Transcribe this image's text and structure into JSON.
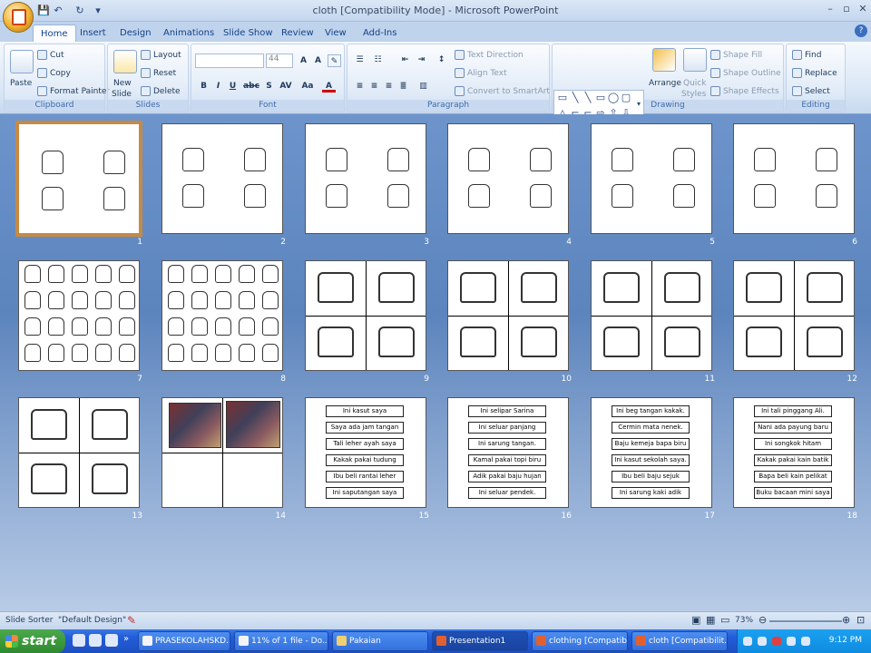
{
  "window": {
    "title": "cloth [Compatibility Mode] - Microsoft PowerPoint",
    "min": "–",
    "restore": "▫",
    "close": "✕"
  },
  "ribbon_tabs": [
    "Home",
    "Insert",
    "Design",
    "Animations",
    "Slide Show",
    "Review",
    "View",
    "Add-Ins"
  ],
  "active_tab": "Home",
  "clipboard": {
    "paste": "Paste",
    "cut": "Cut",
    "copy": "Copy",
    "format_painter": "Format Painter",
    "label": "Clipboard"
  },
  "slides_group": {
    "new_slide_1": "New",
    "new_slide_2": "Slide",
    "layout": "Layout",
    "reset": "Reset",
    "delete": "Delete",
    "label": "Slides"
  },
  "font_group": {
    "font_size": "44",
    "bold": "B",
    "italic": "I",
    "underline": "U",
    "strike": "abc",
    "shadow": "S",
    "spacing": "AV",
    "case": "Aa",
    "color": "A",
    "grow": "A",
    "shrink": "A",
    "label": "Font"
  },
  "paragraph_group": {
    "text_direction": "Text Direction",
    "align_text": "Align Text",
    "convert_smartart": "Convert to SmartArt",
    "label": "Paragraph"
  },
  "drawing_group": {
    "arrange": "Arrange",
    "quick_styles_1": "Quick",
    "quick_styles_2": "Styles",
    "shape_fill": "Shape Fill",
    "shape_outline": "Shape Outline",
    "shape_effects": "Shape Effects",
    "label": "Drawing"
  },
  "editing_group": {
    "find": "Find",
    "replace": "Replace",
    "select": "Select",
    "label": "Editing"
  },
  "slides": [
    {
      "num": "1",
      "kind": "quad-sketch"
    },
    {
      "num": "2",
      "kind": "quad-sketch"
    },
    {
      "num": "3",
      "kind": "quad-sketch"
    },
    {
      "num": "4",
      "kind": "quad-sketch"
    },
    {
      "num": "5",
      "kind": "quad-sketch"
    },
    {
      "num": "6",
      "kind": "quad-sketch"
    },
    {
      "num": "7",
      "kind": "many-sketch"
    },
    {
      "num": "8",
      "kind": "many-sketch"
    },
    {
      "num": "9",
      "kind": "grid"
    },
    {
      "num": "10",
      "kind": "grid"
    },
    {
      "num": "11",
      "kind": "grid"
    },
    {
      "num": "12",
      "kind": "grid"
    },
    {
      "num": "13",
      "kind": "grid"
    },
    {
      "num": "14",
      "kind": "grid-photo"
    },
    {
      "num": "15",
      "kind": "phrases",
      "phrases": [
        "Ini kasut saya",
        "Saya ada jam tangan",
        "Tali leher ayah saya",
        "Kakak pakai tudung",
        "Ibu beli rantai leher",
        "Ini saputangan saya"
      ]
    },
    {
      "num": "16",
      "kind": "phrases",
      "phrases": [
        "Ini selipar Sarina",
        "Ini seluar panjang",
        "Ini sarung tangan.",
        "Kamal pakai topi biru",
        "Adik pakai baju hujan",
        "Ini seluar pendek."
      ]
    },
    {
      "num": "17",
      "kind": "phrases",
      "phrases": [
        "Ini beg tangan kakak.",
        "Cermin mata nenek.",
        "Baju kemeja bapa biru",
        "Ini kasut sekolah saya.",
        "Ibu beli baju sejuk",
        "Ini sarung kaki adik"
      ]
    },
    {
      "num": "18",
      "kind": "phrases",
      "phrases": [
        "Ini tali pinggang Ali.",
        "Nani ada payung baru",
        "Ini songkok hitam",
        "Kakak pakai kain batik",
        "Bapa beli kain pelikat",
        "Buku bacaan mini saya"
      ]
    }
  ],
  "status": {
    "view": "Slide Sorter",
    "theme": "\"Default Design\"",
    "zoom": "73%"
  },
  "taskbar": {
    "start": "start",
    "tasks": [
      "PRASEKOLAHSKD...",
      "11% of 1 file - Do...",
      "Pakaian",
      "Presentation1",
      "clothing [Compatib...",
      "cloth [Compatibilit..."
    ],
    "clock": "9:12 PM"
  },
  "colors": {
    "ribbon_tab_text": "#15428b",
    "sorter_bg": "#5c84bd",
    "selected_border": "#c58a45",
    "taskbar": "#245edb"
  }
}
